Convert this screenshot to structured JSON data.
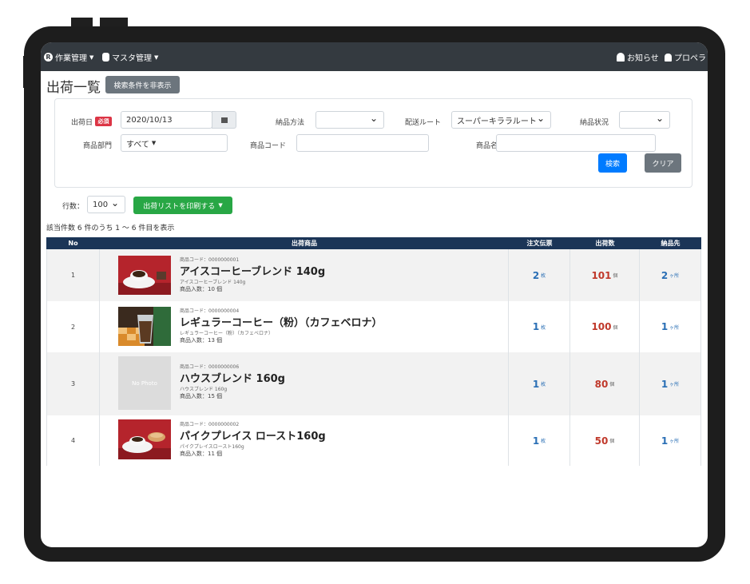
{
  "navbar": {
    "menu1": "作業管理",
    "menu2": "マスタ管理",
    "notice": "お知らせ",
    "user": "プロペラ"
  },
  "page": {
    "title": "出荷一覧",
    "toggle_label": "検索条件を非表示"
  },
  "search": {
    "ship_date_label": "出荷日",
    "required_badge": "必須",
    "ship_date_value": "2020/10/13",
    "delivery_method_label": "納品方法",
    "delivery_method_value": "",
    "route_label": "配送ルート",
    "route_value": "スーパーキララルート",
    "delivery_status_label": "納品状況",
    "delivery_status_value": "",
    "department_label": "商品部門",
    "department_value": "すべて",
    "product_code_label": "商品コード",
    "product_code_value": "",
    "product_name_label": "商品名",
    "product_name_value": "",
    "search_button": "検索",
    "clear_button": "クリア"
  },
  "list_controls": {
    "rows_label": "行数：",
    "rows_value": "100",
    "print_button": "出荷リストを印刷する",
    "count_text": "該当件数 6 件のうち 1 〜 6 件目を表示"
  },
  "table": {
    "headers": {
      "no": "No",
      "product": "出荷商品",
      "orders": "注文伝票",
      "shipped": "出荷数",
      "destinations": "納品先"
    },
    "rows": [
      {
        "no": "1",
        "code": "商品コード：0000000001",
        "name": "アイスコーヒーブレンド 140g",
        "subname": "アイスコーヒーブレンド 140g",
        "pack": "商品入数：10 個",
        "photo": "coffee-cup-photo",
        "orders": "2",
        "orders_unit": "枚",
        "shipped": "101",
        "shipped_unit": "個",
        "dest": "2",
        "dest_unit": "ヶ所"
      },
      {
        "no": "2",
        "code": "商品コード：0000000004",
        "name": "レギュラーコーヒー（粉）（カフェベロナ）",
        "subname": "レギュラーコーヒー（粉）（カフェベロナ）",
        "pack": "商品入数：13 個",
        "photo": "iced-coffee-photo",
        "orders": "1",
        "orders_unit": "枚",
        "shipped": "100",
        "shipped_unit": "個",
        "dest": "1",
        "dest_unit": "ヶ所"
      },
      {
        "no": "3",
        "code": "商品コード：0000000006",
        "name": "ハウスブレンド 160g",
        "subname": "ハウスブレンド 160g",
        "pack": "商品入数：15 個",
        "photo_text": "No Photo",
        "orders": "1",
        "orders_unit": "枚",
        "shipped": "80",
        "shipped_unit": "個",
        "dest": "1",
        "dest_unit": "ヶ所"
      },
      {
        "no": "4",
        "code": "商品コード：0000000002",
        "name": "パイクプレイス ロースト160g",
        "subname": "パイクプレイスロースト160g",
        "pack": "商品入数：11 個",
        "photo": "coffee-cake-photo",
        "orders": "1",
        "orders_unit": "枚",
        "shipped": "50",
        "shipped_unit": "個",
        "dest": "1",
        "dest_unit": "ヶ所"
      }
    ]
  },
  "colors": {
    "navbar": "#343a40",
    "table_header": "#1b3557",
    "primary": "#007bff",
    "success": "#28a745",
    "danger": "#dc3545",
    "count_blue": "#2a6fb5",
    "count_red": "#c0392b"
  }
}
